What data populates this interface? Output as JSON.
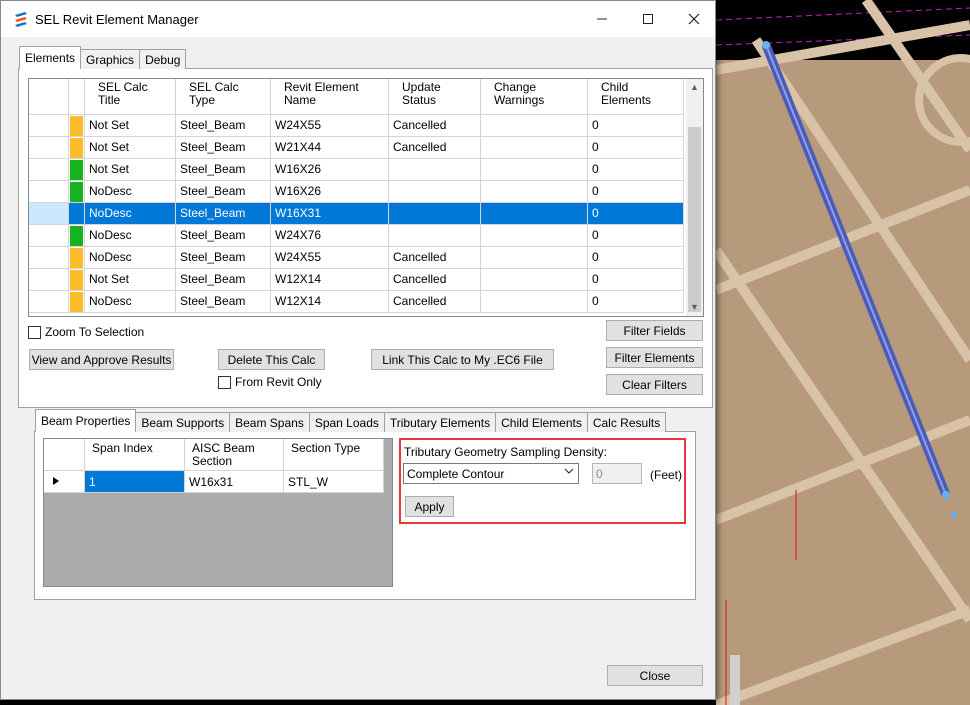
{
  "window": {
    "title": "SEL Revit Element Manager"
  },
  "main_tabs": [
    {
      "label": "Elements",
      "active": true
    },
    {
      "label": "Graphics",
      "active": false
    },
    {
      "label": "Debug",
      "active": false
    }
  ],
  "elements_grid": {
    "columns": [
      "SEL Calc\nTitle",
      "SEL Calc\nType",
      "Revit Element\nName",
      "Update\nStatus",
      "Change\nWarnings",
      "Child\nElements"
    ],
    "rows": [
      {
        "flag": "#fbbc2a",
        "title": "Not Set",
        "type": "Steel_Beam",
        "name": "W24X55",
        "status": "Cancelled",
        "warnings": "",
        "children": "0",
        "selected": false
      },
      {
        "flag": "#fbbc2a",
        "title": "Not Set",
        "type": "Steel_Beam",
        "name": "W21X44",
        "status": "Cancelled",
        "warnings": "",
        "children": "0",
        "selected": false
      },
      {
        "flag": "#17b31d",
        "title": "Not Set",
        "type": "Steel_Beam",
        "name": "W16X26",
        "status": "",
        "warnings": "",
        "children": "0",
        "selected": false
      },
      {
        "flag": "#17b31d",
        "title": "NoDesc",
        "type": "Steel_Beam",
        "name": "W16X26",
        "status": "",
        "warnings": "",
        "children": "0",
        "selected": false
      },
      {
        "flag": "#0078d7",
        "title": "NoDesc",
        "type": "Steel_Beam",
        "name": "W16X31",
        "status": "",
        "warnings": "",
        "children": "0",
        "selected": true
      },
      {
        "flag": "#17b31d",
        "title": "NoDesc",
        "type": "Steel_Beam",
        "name": "W24X76",
        "status": "",
        "warnings": "",
        "children": "0",
        "selected": false
      },
      {
        "flag": "#fbbc2a",
        "title": "NoDesc",
        "type": "Steel_Beam",
        "name": "W24X55",
        "status": "Cancelled",
        "warnings": "",
        "children": "0",
        "selected": false
      },
      {
        "flag": "#fbbc2a",
        "title": "Not Set",
        "type": "Steel_Beam",
        "name": "W12X14",
        "status": "Cancelled",
        "warnings": "",
        "children": "0",
        "selected": false
      },
      {
        "flag": "#fbbc2a",
        "title": "NoDesc",
        "type": "Steel_Beam",
        "name": "W12X14",
        "status": "Cancelled",
        "warnings": "",
        "children": "0",
        "selected": false
      }
    ]
  },
  "controls": {
    "zoom_to_selection": "Zoom To Selection",
    "view_approve": "View and Approve Results",
    "delete_calc": "Delete This Calc",
    "from_revit_only": "From Revit Only",
    "link_calc": "Link This Calc to My .EC6 File",
    "filter_fields": "Filter Fields",
    "filter_elements": "Filter Elements",
    "clear_filters": "Clear Filters",
    "close": "Close"
  },
  "sub_tabs": [
    {
      "label": "Beam Properties",
      "active": true
    },
    {
      "label": "Beam Supports",
      "active": false
    },
    {
      "label": "Beam Spans",
      "active": false
    },
    {
      "label": "Span Loads",
      "active": false
    },
    {
      "label": "Tributary Elements",
      "active": false
    },
    {
      "label": "Child Elements",
      "active": false
    },
    {
      "label": "Calc Results",
      "active": false
    }
  ],
  "beam_grid": {
    "columns": [
      "Span Index",
      "AISC Beam\nSection",
      "Section Type"
    ],
    "rows": [
      {
        "span_index": "1",
        "section": "W16x31",
        "section_type": "STL_W"
      }
    ]
  },
  "tributary": {
    "label": "Tributary Geometry Sampling Density:",
    "mode": "Complete Contour",
    "value": "0",
    "unit": "(Feet)",
    "apply": "Apply"
  }
}
